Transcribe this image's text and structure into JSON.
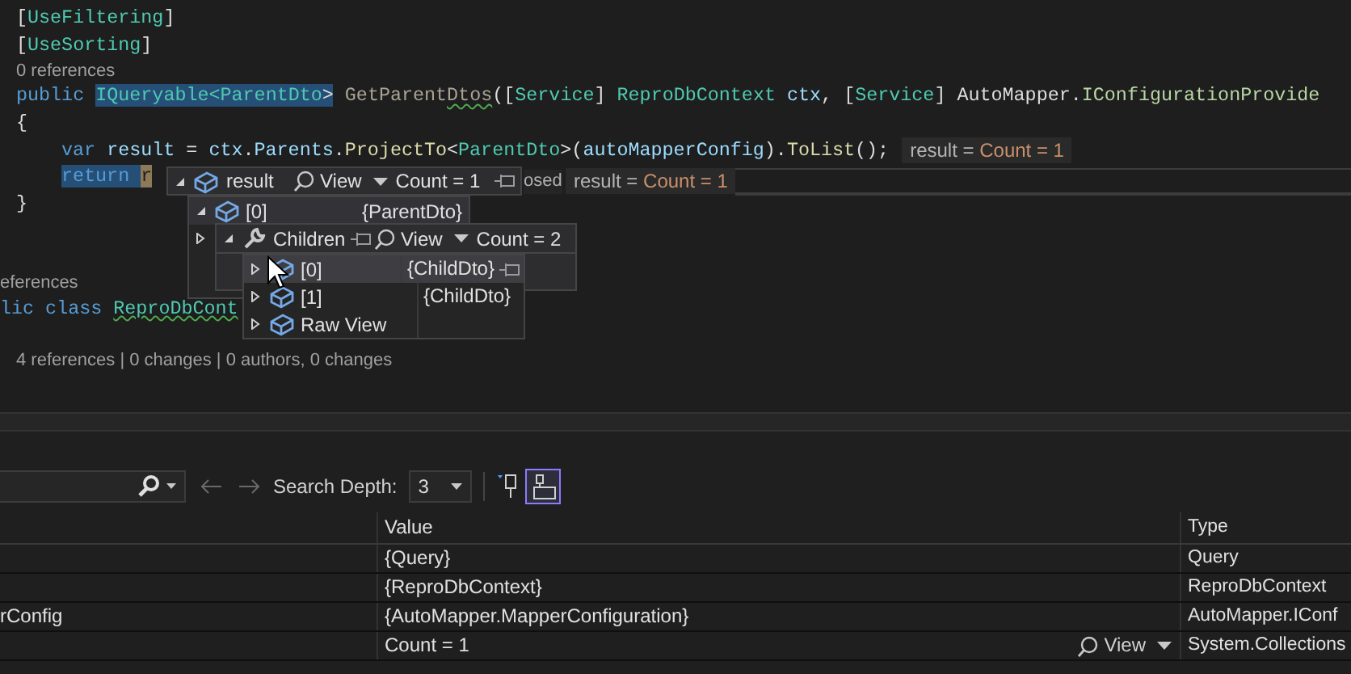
{
  "editor": {
    "lines": [
      {
        "kind": "code",
        "tokens": [
          {
            "text": "[",
            "kind": "punct"
          },
          {
            "text": "UseFiltering",
            "kind": "type"
          },
          {
            "text": "]",
            "kind": "punct"
          }
        ]
      },
      {
        "kind": "code",
        "tokens": [
          {
            "text": "[",
            "kind": "punct"
          },
          {
            "text": "UseSorting",
            "kind": "type"
          },
          {
            "text": "]",
            "kind": "punct"
          }
        ]
      },
      {
        "kind": "lens",
        "text": "0 references"
      },
      {
        "kind": "code",
        "tokens": [
          {
            "text": "public ",
            "kind": "keyword"
          },
          {
            "text": "IQueryable<",
            "kind": "type",
            "selected": true
          },
          {
            "text": "ParentDto",
            "kind": "type",
            "selected": true
          },
          {
            "text": ">",
            "kind": "punct",
            "selected": true
          },
          {
            "text": " GetParent",
            "kind": "unused"
          },
          {
            "text": "Dtos",
            "kind": "unused",
            "squiggle": true
          },
          {
            "text": "([",
            "kind": "punct"
          },
          {
            "text": "Service",
            "kind": "type"
          },
          {
            "text": "] ",
            "kind": "punct"
          },
          {
            "text": "ReproDbContext ",
            "kind": "type"
          },
          {
            "text": "ctx",
            "kind": "variable"
          },
          {
            "text": ", [",
            "kind": "punct"
          },
          {
            "text": "Service",
            "kind": "type"
          },
          {
            "text": "] AutoMapper.",
            "kind": "punct"
          },
          {
            "text": "IConfigurationProvide",
            "kind": "interface"
          }
        ]
      },
      {
        "kind": "code",
        "tokens": [
          {
            "text": "{",
            "kind": "punct"
          }
        ]
      },
      {
        "kind": "code",
        "indented": true,
        "tokens": [
          {
            "text": "var ",
            "kind": "keyword"
          },
          {
            "text": "result",
            "kind": "variable"
          },
          {
            "text": " = ",
            "kind": "punct"
          },
          {
            "text": "ctx",
            "kind": "variable"
          },
          {
            "text": ".",
            "kind": "punct"
          },
          {
            "text": "Parents",
            "kind": "variable"
          },
          {
            "text": ".",
            "kind": "punct"
          },
          {
            "text": "ProjectTo",
            "kind": "method"
          },
          {
            "text": "<",
            "kind": "punct"
          },
          {
            "text": "ParentDto",
            "kind": "type"
          },
          {
            "text": ">(",
            "kind": "punct"
          },
          {
            "text": "autoMapperConfig",
            "kind": "variable"
          },
          {
            "text": ").",
            "kind": "punct"
          },
          {
            "text": "ToList",
            "kind": "method"
          },
          {
            "text": "();",
            "kind": "punct"
          }
        ],
        "hint": {
          "label": "result =",
          "value": "Count = 1"
        }
      },
      {
        "kind": "code",
        "indented": true,
        "tokens": [
          {
            "text": "return ",
            "kind": "keyword",
            "selected": true
          },
          {
            "text": "r",
            "kind": "variable",
            "highlighted": true
          }
        ]
      },
      {
        "kind": "code",
        "tokens": [
          {
            "text": "}",
            "kind": "punct"
          }
        ]
      },
      {
        "kind": "blank"
      },
      {
        "kind": "blank"
      },
      {
        "kind": "lens",
        "text": "eferences",
        "flush": true
      },
      {
        "kind": "code",
        "flush": true,
        "tokens": [
          {
            "text": "lic class ",
            "kind": "keyword"
          },
          {
            "text": "ReproDbCont",
            "kind": "type",
            "squiggle": true
          }
        ]
      },
      {
        "kind": "blank"
      },
      {
        "kind": "lens",
        "text": "4 references | 0 changes | 0 authors, 0 changes"
      }
    ]
  },
  "return_hint": {
    "fragment": "osed",
    "label": "result =",
    "value": "Count = 1"
  },
  "datatip": {
    "name": "result",
    "view": "View",
    "value": "Count = 1",
    "expanded": true,
    "children": [
      {
        "name": "[0]",
        "value": "{ParentDto}",
        "expanded": true,
        "children": [
          {
            "name": "Children",
            "view": "View",
            "value": "Count = 2",
            "expanded": true,
            "children": [
              {
                "name": "[0]",
                "value": "{ChildDto}",
                "expanded": false,
                "selected": true
              },
              {
                "name": "[1]",
                "value": "{ChildDto}",
                "expanded": false,
                "selected": false
              },
              {
                "name": "Raw View",
                "expanded": false,
                "selected": false
              }
            ]
          }
        ]
      }
    ]
  },
  "locals": {
    "toolbar": {
      "depth_label": "Search Depth:",
      "depth": "3",
      "raw_toggle": {
        "selected": true
      }
    },
    "columns": [
      {
        "label": "Value"
      },
      {
        "label": "Type"
      }
    ],
    "rows": [
      {
        "value": "{Query}",
        "type": "Query"
      },
      {
        "value": "{ReproDbContext}",
        "type": "ReproDbContext"
      },
      {
        "name": "rConfig",
        "value": "{AutoMapper.MapperConfiguration}",
        "type": "AutoMapper.IConf"
      },
      {
        "value": "Count = 1",
        "view": "View",
        "type": "System.Collections"
      }
    ]
  }
}
